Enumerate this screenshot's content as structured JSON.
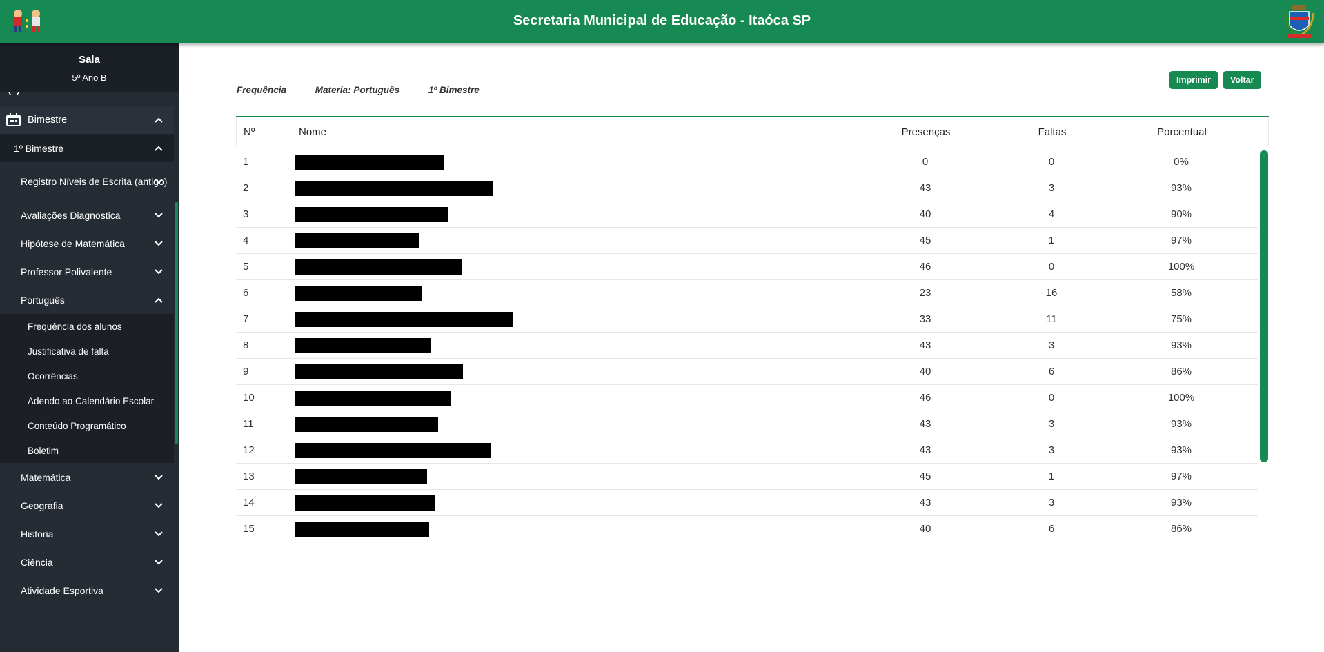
{
  "header": {
    "title": "Secretaria Municipal de Educação - Itaóca SP"
  },
  "sala": {
    "title": "Sala",
    "subtitle": "5º Ano B"
  },
  "menu": {
    "bimestre_label": "Bimestre",
    "first_bimestre": "1º Bimestre",
    "groups": [
      "Registro Níveis de Escrita (antigo)",
      "Avaliações Diagnostica",
      "Hipótese de Matemática",
      "Professor Polivalente",
      "Português"
    ],
    "portugues_items": [
      "Frequência dos alunos",
      "Justificativa de falta",
      "Ocorrências",
      "Adendo ao Calendário Escolar",
      "Conteúdo Programático",
      "Boletim"
    ],
    "subjects": [
      "Matemática",
      "Geografia",
      "Historia",
      "Ciência",
      "Atividade Esportiva"
    ]
  },
  "crumbs": {
    "page": "Frequência",
    "materia": "Materia: Português",
    "bimestre": "1º Bimestre"
  },
  "buttons": {
    "print": "Imprimir",
    "back": "Voltar"
  },
  "table": {
    "headers": {
      "num": "Nº",
      "name": "Nome",
      "presencas": "Presenças",
      "faltas": "Faltas",
      "porcentual": "Porcentual"
    },
    "rows": [
      {
        "num": "1",
        "presencas": "0",
        "faltas": "0",
        "porcentual": "0%"
      },
      {
        "num": "2",
        "presencas": "43",
        "faltas": "3",
        "porcentual": "93%"
      },
      {
        "num": "3",
        "presencas": "40",
        "faltas": "4",
        "porcentual": "90%"
      },
      {
        "num": "4",
        "presencas": "45",
        "faltas": "1",
        "porcentual": "97%"
      },
      {
        "num": "5",
        "presencas": "46",
        "faltas": "0",
        "porcentual": "100%"
      },
      {
        "num": "6",
        "presencas": "23",
        "faltas": "16",
        "porcentual": "58%"
      },
      {
        "num": "7",
        "presencas": "33",
        "faltas": "11",
        "porcentual": "75%"
      },
      {
        "num": "8",
        "presencas": "43",
        "faltas": "3",
        "porcentual": "93%"
      },
      {
        "num": "9",
        "presencas": "40",
        "faltas": "6",
        "porcentual": "86%"
      },
      {
        "num": "10",
        "presencas": "46",
        "faltas": "0",
        "porcentual": "100%"
      },
      {
        "num": "11",
        "presencas": "43",
        "faltas": "3",
        "porcentual": "93%"
      },
      {
        "num": "12",
        "presencas": "43",
        "faltas": "3",
        "porcentual": "93%"
      },
      {
        "num": "13",
        "presencas": "45",
        "faltas": "1",
        "porcentual": "97%"
      },
      {
        "num": "14",
        "presencas": "43",
        "faltas": "3",
        "porcentual": "93%"
      },
      {
        "num": "15",
        "presencas": "40",
        "faltas": "6",
        "porcentual": "86%"
      }
    ]
  },
  "colors": {
    "brand": "#168a52",
    "sidebar": "#252b33"
  }
}
